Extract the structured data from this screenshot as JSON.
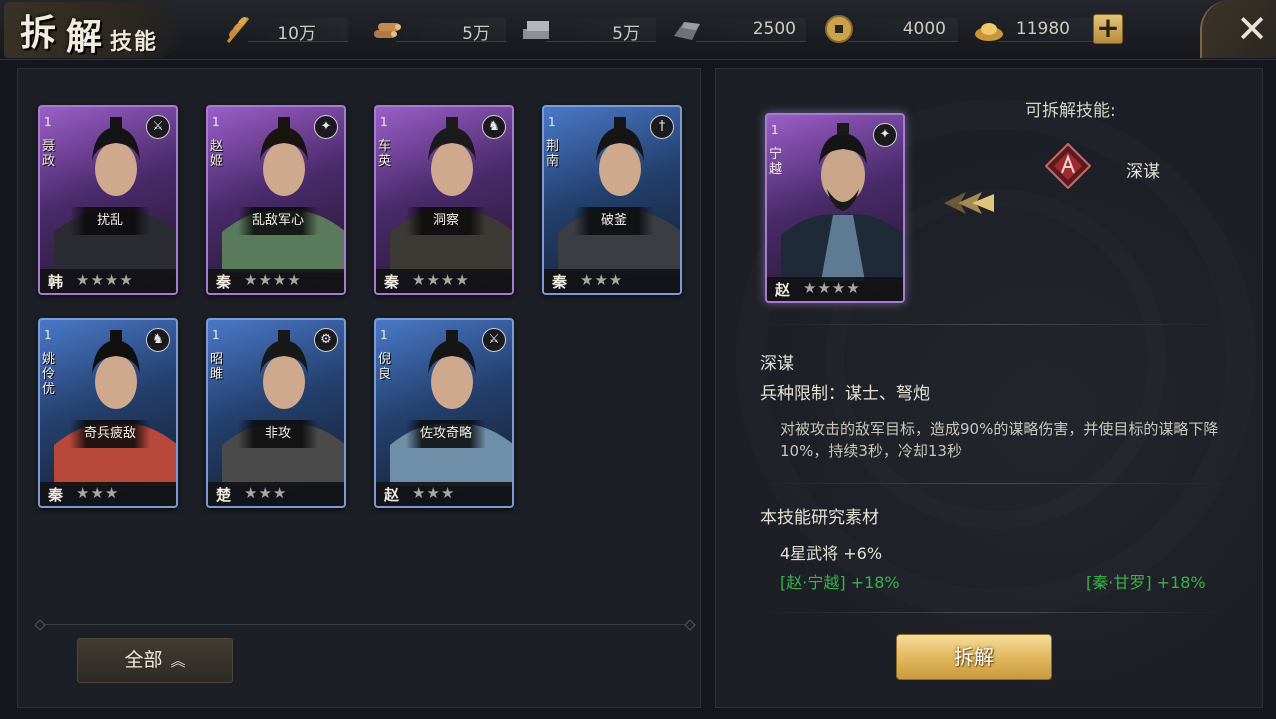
{
  "header": {
    "title_char1": "拆",
    "title_char2": "解",
    "title_small": "技能",
    "resources": [
      {
        "icon": "grain-icon",
        "value": "10万"
      },
      {
        "icon": "wood-icon",
        "value": "5万"
      },
      {
        "icon": "stone-icon",
        "value": "5万"
      },
      {
        "icon": "iron-icon",
        "value": "2500"
      },
      {
        "icon": "copper-coin-icon",
        "value": "4000"
      },
      {
        "icon": "gold-ingot-icon",
        "value": "11980"
      }
    ],
    "plus_label": "+",
    "close_label": "✕"
  },
  "generals": [
    {
      "name": "聂政",
      "level": "1",
      "skill": "扰乱",
      "nation": "韩",
      "stars": "★★★★",
      "rarity": "purple",
      "badge": "⚔"
    },
    {
      "name": "赵姬",
      "level": "1",
      "skill": "乱敌军心",
      "nation": "秦",
      "stars": "★★★★",
      "rarity": "purple",
      "badge": "✦"
    },
    {
      "name": "车英",
      "level": "1",
      "skill": "洞察",
      "nation": "秦",
      "stars": "★★★★",
      "rarity": "purple",
      "badge": "♞"
    },
    {
      "name": "荆南",
      "level": "1",
      "skill": "破釜",
      "nation": "秦",
      "stars": "★★★",
      "rarity": "blue",
      "badge": "†"
    },
    {
      "name": "姚伶优",
      "level": "1",
      "skill": "奇兵疲敌",
      "nation": "秦",
      "stars": "★★★",
      "rarity": "blue",
      "badge": "♞"
    },
    {
      "name": "昭雎",
      "level": "1",
      "skill": "非攻",
      "nation": "楚",
      "stars": "★★★",
      "rarity": "blue",
      "badge": "⚙"
    },
    {
      "name": "倪良",
      "level": "1",
      "skill": "佐攻奇略",
      "nation": "赵",
      "stars": "★★★",
      "rarity": "blue",
      "badge": "⚔"
    }
  ],
  "filter": {
    "label": "全部",
    "chevron": "︽"
  },
  "selected": {
    "name": "宁越",
    "level": "1",
    "nation": "赵",
    "stars": "★★★★",
    "badge": "✦",
    "decompose_label": "可拆解技能:",
    "skill_name": "深谋",
    "skill_title": "深谋",
    "troop_limit": "兵种限制：谋士、弩炮",
    "description": "对被攻击的敌军目标，造成90%的谋略伤害，并使目标的谋略下降10%，持续3秒，冷却13秒",
    "research_title": "本技能研究素材",
    "materials": [
      "4星武将 +6%",
      "[赵·宁越] +18%",
      "[秦·甘罗] +18%"
    ],
    "button": "拆解"
  },
  "colors": {
    "accent_gold": "#e3b960",
    "green_text": "#39b24a",
    "purple_rarity": "#a77bd0",
    "blue_rarity": "#7d9bd6"
  }
}
